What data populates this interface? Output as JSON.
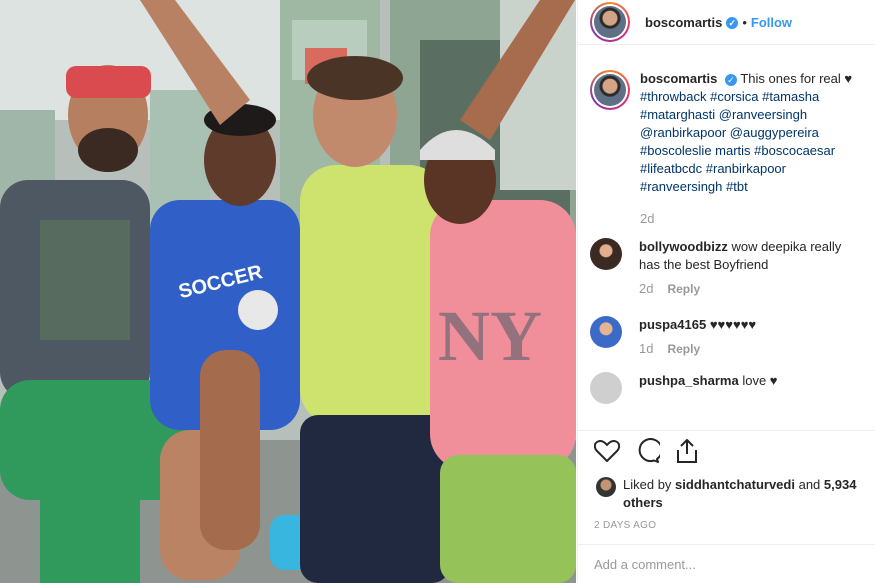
{
  "header": {
    "username": "boscomartis",
    "separator": "•",
    "follow_label": "Follow",
    "verified_mark": "✓"
  },
  "caption": {
    "username": "boscomartis",
    "text": "This ones for real ♥",
    "hashtags": "#throwback #corsica #tamasha #matarghasti @ranveersingh @ranbirkapoor @auggypereira #boscoleslie martis #boscocaesar #lifeatbcdc #ranbirkapoor #ranveersingh #tbt",
    "age": "2d"
  },
  "comments": [
    {
      "username": "bollywoodbizz",
      "text": "wow deepika really has the best Boyfriend",
      "age": "2d",
      "reply_label": "Reply"
    },
    {
      "username": "puspa4165",
      "text": "♥♥♥♥♥♥",
      "age": "1d",
      "reply_label": "Reply"
    },
    {
      "username": "pushpa_sharma",
      "text": "love ♥"
    }
  ],
  "likes": {
    "prefix": "Liked by",
    "user": "siddhantchaturvedi",
    "joiner": "and",
    "others": "5,934 others"
  },
  "post_date": "2 DAYS AGO",
  "add_comment": {
    "placeholder": "Add a comment..."
  },
  "colors": {
    "link_blue": "#3897f0",
    "hashtag": "#003569",
    "muted": "#999999"
  },
  "icons": [
    "heart-icon",
    "comment-icon",
    "share-icon"
  ]
}
